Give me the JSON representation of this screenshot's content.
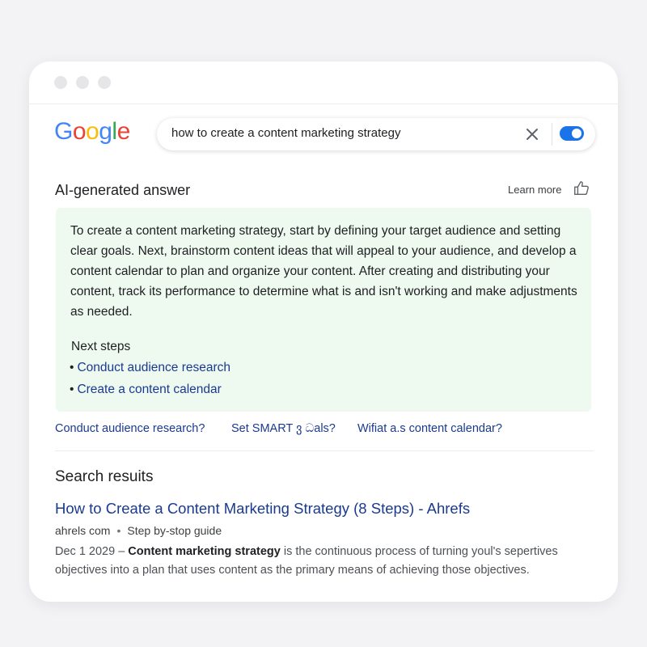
{
  "header": {
    "logo": {
      "letters": [
        "G",
        "o",
        "o",
        "g",
        "l",
        "e"
      ],
      "colors": [
        "#4285F4",
        "#EA4335",
        "#FBBC05",
        "#4285F4",
        "#34A853",
        "#EA4335"
      ]
    },
    "search": {
      "query": "how to create a content marketing strategy"
    },
    "toggle_on": true
  },
  "ai": {
    "heading": "AI-generated answer",
    "learn_more": "Learn more",
    "paragraph": "To create a content marketing strategy, start by defining your target audience and setting clear goals. Next, brainstorm content ideas that will appeal to your audience, and develop a content calendar to plan and organize your content. After creating and distributing your content, track its performance to determine what is and isn't working and make adjustments as needed.",
    "next_steps_label": "Next steps",
    "steps": [
      {
        "bullet": "•",
        "label": "Conduct  audience research"
      },
      {
        "bullet": "•",
        "label": "Create a content calendar"
      }
    ],
    "accent_color": "#eef9f0"
  },
  "suggestions": [
    "Conduct audience research?",
    "Set SMART ვ ධals?",
    "Wifiat a.s content calendar?"
  ],
  "results": {
    "heading": "Search resuits",
    "items": [
      {
        "title": "How to Create a Content Marketing Strategy (8 Steps) - Ahrefs",
        "site": "ahrels com",
        "separator": "•",
        "breadcrumb": "Step by-stop guide",
        "date": "Dec 1 2029 –",
        "bold_phrase": "Content marketing strategy",
        "snippet_rest": "is the continuous process of turning youl's sepertives objectives into a plan that uses content as the primary means of achieving those objectives."
      }
    ]
  },
  "colors": {
    "link": "#1a3a8f",
    "toggle": "#1a73e8"
  }
}
